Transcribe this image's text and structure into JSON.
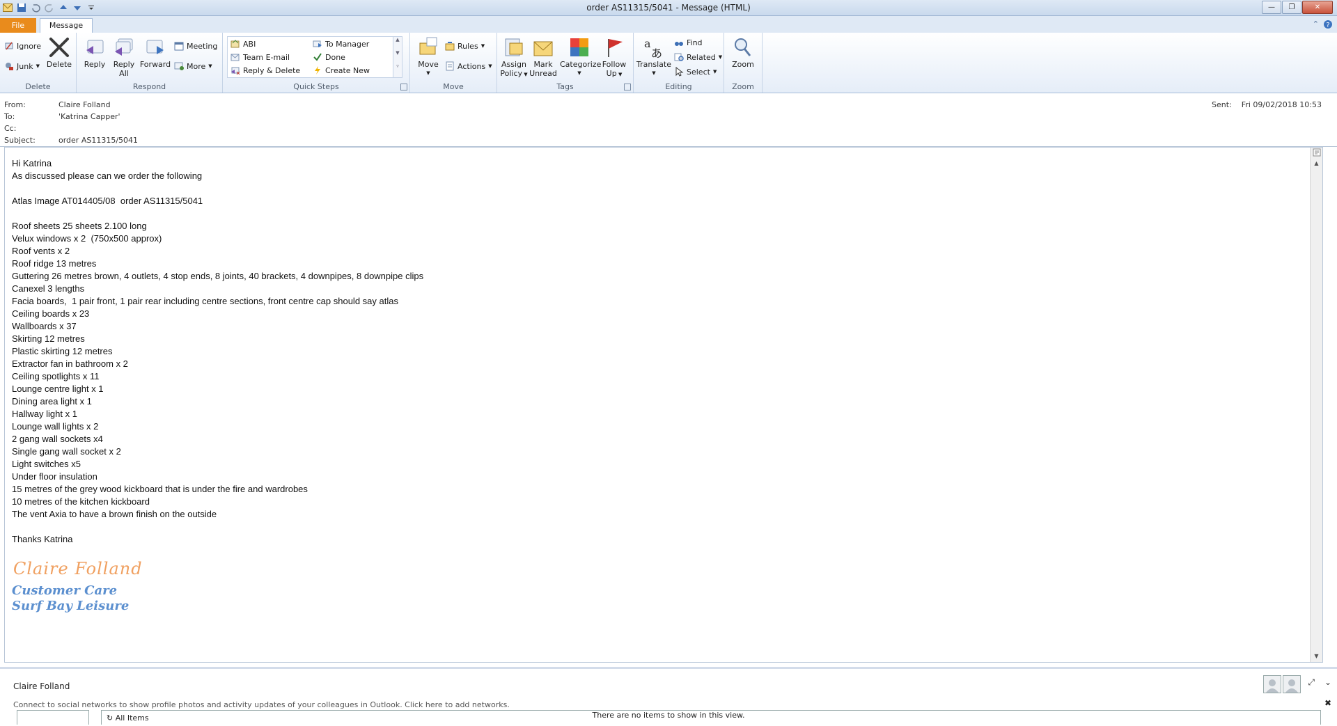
{
  "window": {
    "title": "order AS11315/5041  -  Message (HTML)"
  },
  "tabs": {
    "file": "File",
    "message": "Message"
  },
  "ribbon": {
    "delete_group": {
      "label": "Delete",
      "ignore": "Ignore",
      "junk": "Junk",
      "delete": "Delete"
    },
    "respond_group": {
      "label": "Respond",
      "reply": "Reply",
      "reply_all_1": "Reply",
      "reply_all_2": "All",
      "forward": "Forward",
      "meeting": "Meeting",
      "more": "More"
    },
    "quick_steps": {
      "label": "Quick Steps",
      "items": [
        "ABI",
        "To Manager",
        "Team E-mail",
        "Done",
        "Reply & Delete",
        "Create New"
      ]
    },
    "move_group": {
      "label": "Move",
      "move": "Move",
      "rules": "Rules",
      "actions": "Actions"
    },
    "tags_group": {
      "label": "Tags",
      "assign_1": "Assign",
      "assign_2": "Policy",
      "mark_1": "Mark",
      "mark_2": "Unread",
      "categorize": "Categorize",
      "follow_1": "Follow",
      "follow_2": "Up"
    },
    "editing_group": {
      "label": "Editing",
      "translate": "Translate",
      "find": "Find",
      "related": "Related",
      "select": "Select"
    },
    "zoom_group": {
      "label": "Zoom",
      "zoom": "Zoom"
    }
  },
  "header": {
    "from_label": "From:",
    "from": "Claire Folland",
    "to_label": "To:",
    "to": "'Katrina Capper'",
    "cc_label": "Cc:",
    "cc": "",
    "subject_label": "Subject:",
    "subject": "order AS11315/5041",
    "sent_label": "Sent:",
    "sent": "Fri 09/02/2018 10:53"
  },
  "body": {
    "lines": [
      "Hi Katrina",
      "As discussed please can we order the following",
      "",
      "Atlas Image AT014405/08  order AS11315/5041",
      "",
      "Roof sheets 25 sheets 2.100 long",
      "Velux windows x 2  (750x500 approx)",
      "Roof vents x 2",
      "Roof ridge 13 metres",
      "Guttering 26 metres brown, 4 outlets, 4 stop ends, 8 joints, 40 brackets, 4 downpipes, 8 downpipe clips",
      "Canexel 3 lengths",
      "Facia boards,  1 pair front, 1 pair rear including centre sections, front centre cap should say atlas",
      "Ceiling boards x 23",
      "Wallboards x 37",
      "Skirting 12 metres",
      "Plastic skirting 12 metres",
      "Extractor fan in bathroom x 2",
      "Ceiling spotlights x 11",
      "Lounge centre light x 1",
      "Dining area light x 1",
      "Hallway light x 1",
      "Lounge wall lights x 2",
      "2 gang wall sockets x4",
      "Single gang wall socket x 2",
      "Light switches x5",
      "Under floor insulation",
      "15 metres of the grey wood kickboard that is under the fire and wardrobes",
      "10 metres of the kitchen kickboard",
      "The vent Axia to have a brown finish on the outside",
      "",
      "Thanks Katrina"
    ],
    "signature_name": "Claire Folland",
    "signature_line1": "Customer Care",
    "signature_line2": "Surf Bay Leisure"
  },
  "people_pane": {
    "name": "Claire Folland",
    "message": "Connect to social networks to show profile photos and activity updates of your colleagues in Outlook. Click here to add networks."
  },
  "status": {
    "folder": "All Items",
    "empty": "There are no items to show in this view."
  },
  "colors": {
    "file_tab": "#e98b1c",
    "signature_name": "#f0a060",
    "signature_text": "#5b8fcf"
  }
}
